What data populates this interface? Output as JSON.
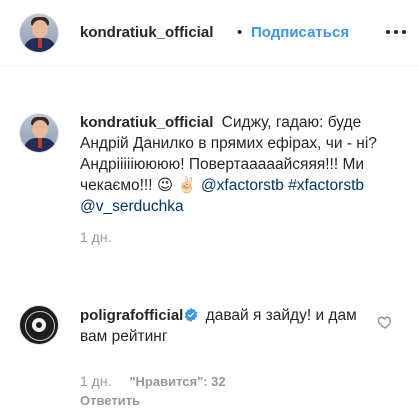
{
  "header": {
    "username": "kondratiuk_official",
    "separator": "•",
    "follow_label": "Подписаться",
    "more_icon": "more-horizontal-icon"
  },
  "caption": {
    "username": "kondratiuk_official",
    "text": "Сиджу, гадаю: буде Андрій Данилко в прямих ефірах, чи - ні? Андріііііюююю! Повертааааайсяяя!!! Ми чекаємо!!! 😉 ✌🏻",
    "tags": [
      "@xfactorstb",
      "#xfactorstb",
      "@v_serduchka"
    ],
    "time": "1 дн."
  },
  "comment": {
    "username": "poligrafofficial",
    "verified": true,
    "text": "давай я зайду! и дам вам рейтинг",
    "time": "1 дн.",
    "likes": "\"Нравится\": 32",
    "reply_label": "Ответить",
    "like_icon": "heart-outline-icon"
  },
  "colors": {
    "link": "#3897f0",
    "tag": "#003569",
    "meta": "#999999",
    "text": "#262626"
  }
}
